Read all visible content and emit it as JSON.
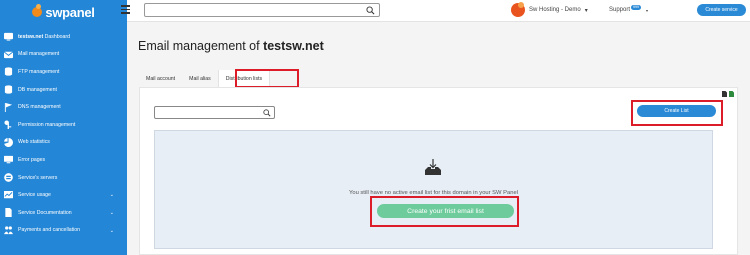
{
  "brand": {
    "logo_text": "swpanel"
  },
  "sidebar": {
    "items": [
      {
        "label_bold": "testsw.net",
        "label": " Dashboard",
        "icon": "dashboard-icon"
      },
      {
        "label": "Mail management",
        "icon": "mail-icon"
      },
      {
        "label": "FTP management",
        "icon": "database-icon"
      },
      {
        "label": "DB management",
        "icon": "database-icon"
      },
      {
        "label": "DNS management",
        "icon": "flag-icon"
      },
      {
        "label": "Permission management",
        "icon": "key-icon"
      },
      {
        "label": "Web statistics",
        "icon": "pie-chart-icon"
      },
      {
        "label": "Error pages",
        "icon": "monitor-icon"
      },
      {
        "label": "Service's servers",
        "icon": "server-icon"
      },
      {
        "label": "Service usage",
        "icon": "usage-icon",
        "chevron": "⌄"
      },
      {
        "label": "Service Documentation",
        "icon": "document-icon",
        "chevron": "⌄"
      },
      {
        "label": "Payments and cancellation",
        "icon": "payments-icon",
        "chevron": "⌄"
      }
    ]
  },
  "topbar": {
    "search_placeholder": "",
    "hosting_label": "Sw Hosting - Demo",
    "hosting_caret": "▾",
    "support_label": "Support",
    "support_badge": "999",
    "support_caret": "▾",
    "create_service_label": "Create service"
  },
  "page": {
    "title_prefix": "Email management of ",
    "title_domain": "testsw.net"
  },
  "tabs": [
    {
      "label": "Mail account",
      "active": false
    },
    {
      "label": "Mail alias",
      "active": false
    },
    {
      "label": "Distribution lists",
      "active": true
    }
  ],
  "panel": {
    "search_placeholder": "",
    "create_list_label": "Create List",
    "empty_message": "You still have no active email list for this domain in your SW Panel",
    "create_first_label": "Create your frist email list"
  },
  "colors": {
    "sidebar_bg": "#2486d6",
    "primary_button": "#2b8ad6",
    "success_button": "#6dcb9c",
    "highlight": "#dd1c2a"
  }
}
